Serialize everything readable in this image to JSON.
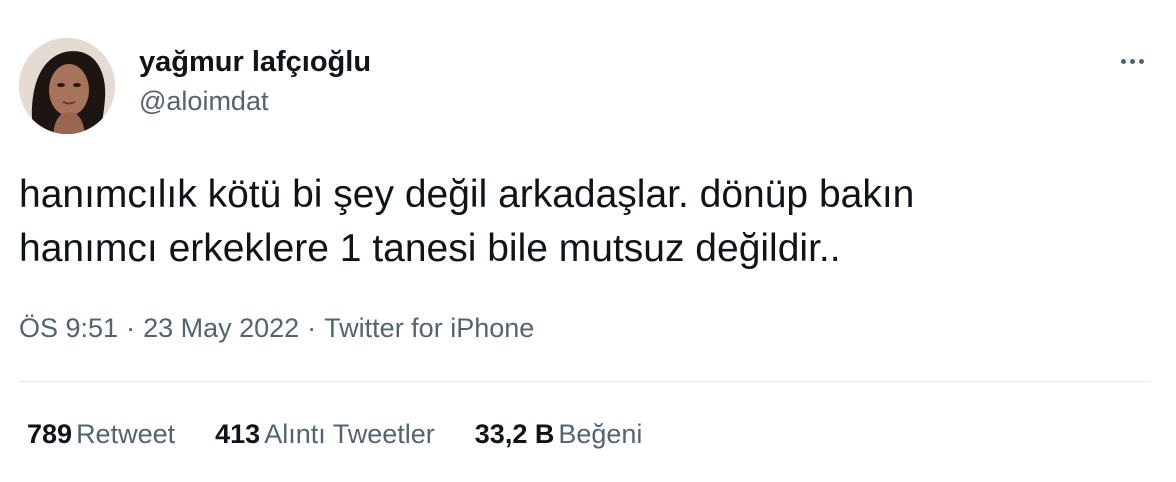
{
  "author": {
    "display_name": "yağmur lafçıoğlu",
    "handle": "@aloimdat",
    "avatar_icon": "profile-photo"
  },
  "more_icon": "more-horizontal-icon",
  "tweet": {
    "text_lines": [
      "hanımcılık kötü bi şey değil arkadaşlar. dönüp bakın",
      "hanımcı erkeklere 1 tanesi bile mutsuz değildir.."
    ],
    "time": "ÖS 9:51",
    "separator": "·",
    "date": "23 May 2022",
    "source": "Twitter for iPhone"
  },
  "stats": {
    "retweets": {
      "count": "789",
      "label": "Retweet"
    },
    "quotes": {
      "count": "413",
      "label": "Alıntı Tweetler"
    },
    "likes": {
      "count": "33,2 B",
      "label": "Beğeni"
    }
  },
  "colors": {
    "text_primary": "#0f1419",
    "text_secondary": "#536471",
    "divider": "#e7e9ea",
    "background": "#ffffff"
  }
}
